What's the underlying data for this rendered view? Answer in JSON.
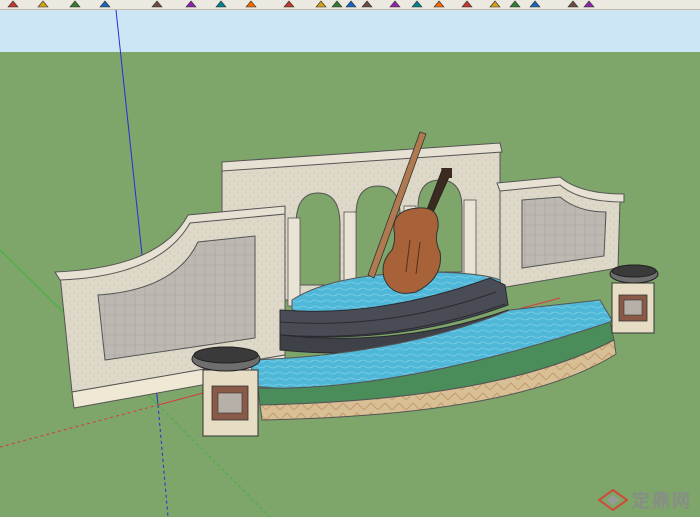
{
  "toolbar": {
    "tools": [
      {
        "name": "select-tool",
        "icon": "arrow-icon"
      },
      {
        "name": "eraser-tool",
        "icon": "eraser-icon"
      },
      {
        "name": "pencil-tool",
        "icon": "pencil-icon"
      },
      {
        "name": "pencil-tool-2",
        "icon": "pencil-icon"
      },
      {
        "name": "rectangle-tool",
        "icon": "rectangle-icon"
      },
      {
        "name": "paint-bucket-tool",
        "icon": "paint-bucket-icon"
      },
      {
        "name": "push-pull-tool",
        "icon": "push-pull-icon"
      },
      {
        "name": "move-tool",
        "icon": "move-icon"
      },
      {
        "name": "rotate-tool",
        "icon": "rotate-icon"
      },
      {
        "name": "offset-tool",
        "icon": "offset-icon"
      },
      {
        "name": "tape-measure-tool",
        "icon": "tape-measure-icon"
      },
      {
        "name": "dimension-tool",
        "icon": "dimension-icon"
      },
      {
        "name": "text-tool",
        "icon": "text-icon"
      },
      {
        "name": "orbit-tool",
        "icon": "orbit-icon"
      },
      {
        "name": "pan-tool",
        "icon": "pan-icon"
      },
      {
        "name": "zoom-tool",
        "icon": "zoom-icon"
      },
      {
        "name": "walk-tool",
        "icon": "walk-icon"
      },
      {
        "name": "look-around-tool",
        "icon": "look-around-icon"
      },
      {
        "name": "position-camera-tool",
        "icon": "position-camera-icon"
      },
      {
        "name": "section-plane-tool",
        "icon": "section-plane-icon"
      },
      {
        "name": "warehouse-tool",
        "icon": "warehouse-icon"
      },
      {
        "name": "share-model-tool",
        "icon": "share-model-icon"
      }
    ]
  },
  "colors": {
    "sky": "#cde6f6",
    "ground": "#7ea56a",
    "toolbar_bg": "#ece9e0",
    "water": "#4fb7d8",
    "wall_stone": "#ddd8c8",
    "wall_panel": "#bdb8b2",
    "steps": "#4a4c55",
    "cello_body": "#a8623a",
    "axis_blue": "#2a2ae0",
    "axis_green": "#3ab83a",
    "axis_red": "#d43c3c"
  },
  "watermark": {
    "text": "定鼎网",
    "icon": "diamond-logo-icon"
  }
}
